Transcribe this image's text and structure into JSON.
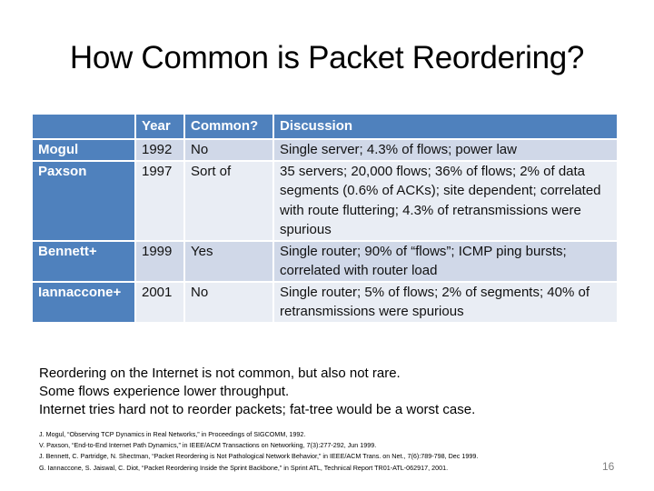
{
  "slide": {
    "title": "How Common is Packet Reordering?",
    "page_number": "16"
  },
  "table": {
    "headers": [
      "",
      "Year",
      "Common?",
      "Discussion"
    ],
    "rows": [
      {
        "study": "Mogul",
        "year": "1992",
        "common": "No",
        "discussion": "Single server; 4.3% of flows; power law"
      },
      {
        "study": "Paxson",
        "year": "1997",
        "common": "Sort of",
        "discussion": "35 servers; 20,000 flows; 36% of flows; 2% of data segments (0.6% of ACKs); site dependent; correlated with route fluttering; 4.3% of retransmissions were spurious"
      },
      {
        "study": "Bennett+",
        "year": "1999",
        "common": "Yes",
        "discussion": "Single router; 90% of “flows”; ICMP ping bursts; correlated with router load"
      },
      {
        "study": "Iannaccone+",
        "year": "2001",
        "common": "No",
        "discussion": "Single router; 5% of flows; 2% of segments; 40% of retransmissions were spurious"
      }
    ]
  },
  "summary": [
    "Reordering on the Internet is not common, but also not rare.",
    "Some flows experience lower throughput.",
    "Internet tries hard not to reorder packets; fat-tree would be a worst case."
  ],
  "references": [
    "J. Mogul, “Observing TCP Dynamics in Real Networks,” in Proceedings of SIGCOMM, 1992.",
    "V. Paxson, “End-to-End Internet Path Dynamics,” in IEEE/ACM Transactions on Networking, 7(3):277-292, Jun 1999.",
    "J. Bennett, C. Partridge, N. Shectman, “Packet Reordering is Not Pathological Network Behavior,” in IEEE/ACM Trans. on Net., 7(6):789-798, Dec 1999.",
    "G. Iannaccone, S. Jaiswal, C. Diot, “Packet Reordering Inside the Sprint Backbone,” in Sprint ATL, Technical Report TR01-ATL-062917, 2001."
  ]
}
